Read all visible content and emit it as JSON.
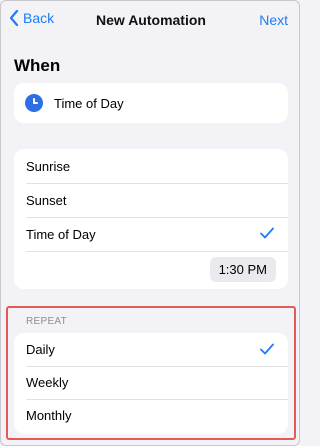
{
  "navbar": {
    "back_label": "Back",
    "title": "New Automation",
    "next_label": "Next"
  },
  "when": {
    "heading": "When",
    "trigger_icon": "clock-icon",
    "trigger_label": "Time of Day"
  },
  "time_options": {
    "items": [
      {
        "label": "Sunrise",
        "selected": false
      },
      {
        "label": "Sunset",
        "selected": false
      },
      {
        "label": "Time of Day",
        "selected": true
      }
    ],
    "time_value": "1:30 PM"
  },
  "repeat": {
    "header": "REPEAT",
    "items": [
      {
        "label": "Daily",
        "selected": true
      },
      {
        "label": "Weekly",
        "selected": false
      },
      {
        "label": "Monthly",
        "selected": false
      }
    ]
  },
  "colors": {
    "accent": "#1e7cf6",
    "highlight": "#e25b57",
    "background": "#f2f2f7"
  }
}
